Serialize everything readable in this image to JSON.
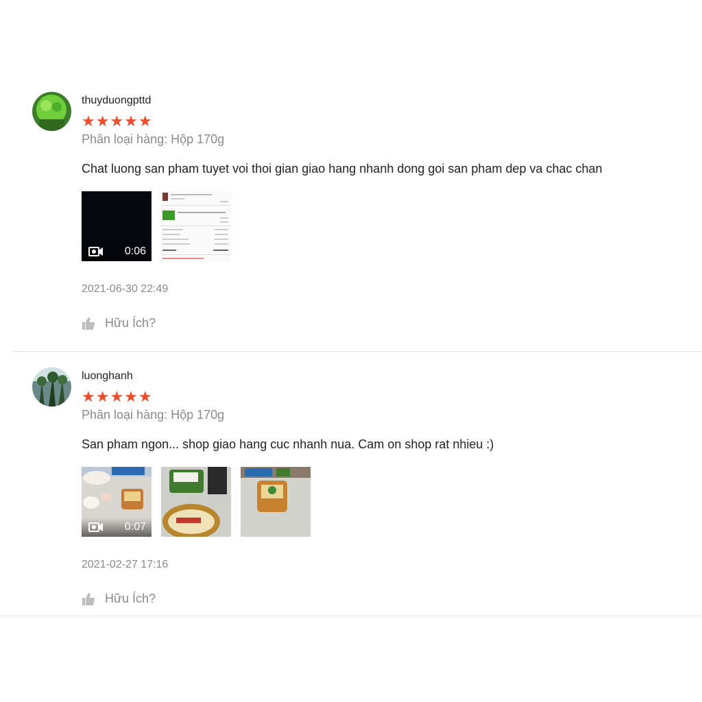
{
  "reviews": [
    {
      "username": "thuyduongpttd",
      "stars": "★★★★★",
      "variation": "Phân loại hàng: Hộp 170g",
      "comment": "Chat luong san pham tuyet voi thoi gian giao hang nhanh dong goi san pham dep va chac chan",
      "video_duration": "0:06",
      "date": "2021-06-30 22:49",
      "helpful_label": "Hữu Ích?"
    },
    {
      "username": "luonghanh",
      "stars": "★★★★★",
      "variation": "Phân loại hàng: Hộp 170g",
      "comment": "San pham ngon... shop giao hang cuc nhanh nua. Cam on shop rat nhieu :)",
      "video_duration": "0:07",
      "date": "2021-02-27 17:16",
      "helpful_label": "Hữu Ích?"
    }
  ],
  "colors": {
    "star": "#ee4d2d",
    "muted_text": "#8a8a8a",
    "divider": "#e5e5e5"
  },
  "icons": [
    "video-camera-icon",
    "thumbs-up-icon"
  ]
}
